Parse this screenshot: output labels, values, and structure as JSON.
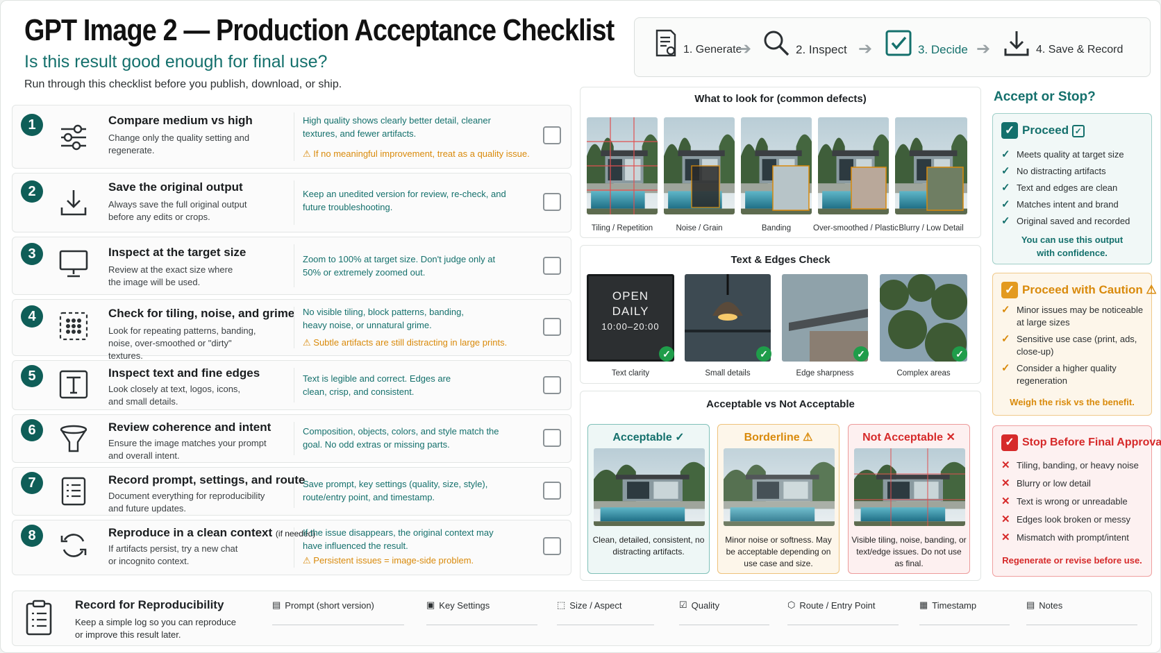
{
  "header": {
    "title": "GPT Image 2 — Production Acceptance Checklist",
    "subtitle": "Is this result good enough for final use?",
    "intro": "Run through this checklist before you publish, download, or ship."
  },
  "workflow": {
    "steps": [
      {
        "label": "1. Generate",
        "icon": "document-edit-icon"
      },
      {
        "label": "2. Inspect",
        "icon": "magnifier-icon"
      },
      {
        "label": "3. Decide",
        "icon": "checkbox-icon"
      },
      {
        "label": "4. Save & Record",
        "icon": "download-icon"
      }
    ]
  },
  "checklist": [
    {
      "num": "1",
      "title": "Compare medium vs high",
      "desc": "Change only the quality setting and regenerate.",
      "tip": "High quality shows clearly better detail, cleaner textures, and fewer artifacts.",
      "warn": "If no meaningful improvement, treat as a quality issue.",
      "icon": "sliders-icon"
    },
    {
      "num": "2",
      "title": "Save the original output",
      "desc": "Always save the full original output before any edits or crops.",
      "tip": "Keep an unedited version for review, re-check, and future troubleshooting.",
      "warn": "",
      "icon": "download-icon"
    },
    {
      "num": "3",
      "title": "Inspect at the target size",
      "desc": "Review at the exact size where the image will be used.",
      "tip": "Zoom to 100% at target size. Don't judge only at 50% or extremely zoomed out.",
      "warn": "",
      "icon": "monitor-icon"
    },
    {
      "num": "4",
      "title": "Check for tiling, noise, and grime",
      "desc": "Look for repeating patterns, banding, noise, over-smoothed or \"dirty\" textures.",
      "tip": "No visible tiling, block patterns, banding, heavy noise, or unnatural grime.",
      "warn": "Subtle artifacts are still distracting in large prints.",
      "icon": "grid-dots-icon"
    },
    {
      "num": "5",
      "title": "Inspect text and fine edges",
      "desc": "Look closely at text, logos, icons, and small details.",
      "tip": "Text is legible and correct. Edges are clean, crisp, and consistent.",
      "warn": "",
      "icon": "text-icon"
    },
    {
      "num": "6",
      "title": "Review coherence and intent",
      "desc": "Ensure the image matches your prompt and overall intent.",
      "tip": "Composition, objects, colors, and style match the goal. No odd extras or missing parts.",
      "warn": "",
      "icon": "funnel-icon"
    },
    {
      "num": "7",
      "title": "Record prompt, settings, and route",
      "desc": "Document everything for reproducibility and future updates.",
      "tip": "Save prompt, key settings (quality, size, style), route/entry point, and timestamp.",
      "warn": "",
      "icon": "list-doc-icon"
    },
    {
      "num": "8",
      "title": "Reproduce in a clean context",
      "title_note": "(if needed)",
      "desc": "If artifacts persist, try a new chat or incognito context.",
      "tip": "If the issue disappears, the original context may have influenced the result.",
      "warn": "Persistent issues = image-side problem.",
      "icon": "refresh-icon"
    }
  ],
  "defects": {
    "title": "What to look for (common defects)",
    "items": [
      "Tiling / Repetition",
      "Noise / Grain",
      "Banding",
      "Over-smoothed / Plastic",
      "Blurry / Low Detail"
    ]
  },
  "text_edges": {
    "title": "Text & Edges Check",
    "sign": [
      "OPEN",
      "DAILY",
      "10:00–20:00"
    ],
    "items": [
      "Text clarity",
      "Small details",
      "Edge sharpness",
      "Complex areas"
    ]
  },
  "acceptability": {
    "title": "Acceptable vs Not Acceptable",
    "cards": [
      {
        "label": "Acceptable",
        "desc": "Clean, detailed, consistent, no distracting artifacts.",
        "color": "#14706c"
      },
      {
        "label": "Borderline",
        "desc": "Minor noise or softness. May be acceptable depending on use case and size.",
        "color": "#d98a0b"
      },
      {
        "label": "Not Acceptable",
        "desc": "Visible tiling, noise, banding, or text/edge issues. Do not use as final.",
        "color": "#d62a2a"
      }
    ]
  },
  "decision": {
    "title": "Accept or Stop?",
    "proceed": {
      "label": "Proceed",
      "items": [
        "Meets quality at target size",
        "No distracting artifacts",
        "Text and edges are clean",
        "Matches intent and brand",
        "Original saved and recorded"
      ],
      "footer": "You can use this output with confidence."
    },
    "caution": {
      "label": "Proceed with Caution",
      "items": [
        "Minor issues may be noticeable at large sizes",
        "Sensitive use case (print, ads, close-up)",
        "Consider a higher quality regeneration"
      ],
      "footer": "Weigh the risk vs the benefit."
    },
    "stop": {
      "label": "Stop Before Final Approval",
      "items": [
        "Tiling, banding, or heavy noise",
        "Blurry or low detail",
        "Text is wrong or unreadable",
        "Edges look broken or messy",
        "Mismatch with prompt/intent"
      ],
      "footer": "Regenerate or revise before use."
    }
  },
  "record": {
    "title": "Record for Reproducibility",
    "desc": "Keep a simple log so you can reproduce or improve this result later.",
    "fields": [
      "Prompt (short version)",
      "Key Settings",
      "Size / Aspect",
      "Quality",
      "Route / Entry Point",
      "Timestamp",
      "Notes"
    ]
  },
  "colors": {
    "teal": "#14706c",
    "dark_teal": "#0f5e58",
    "orange": "#d98a0b",
    "red": "#d62a2a",
    "green": "#1f9d4a"
  }
}
